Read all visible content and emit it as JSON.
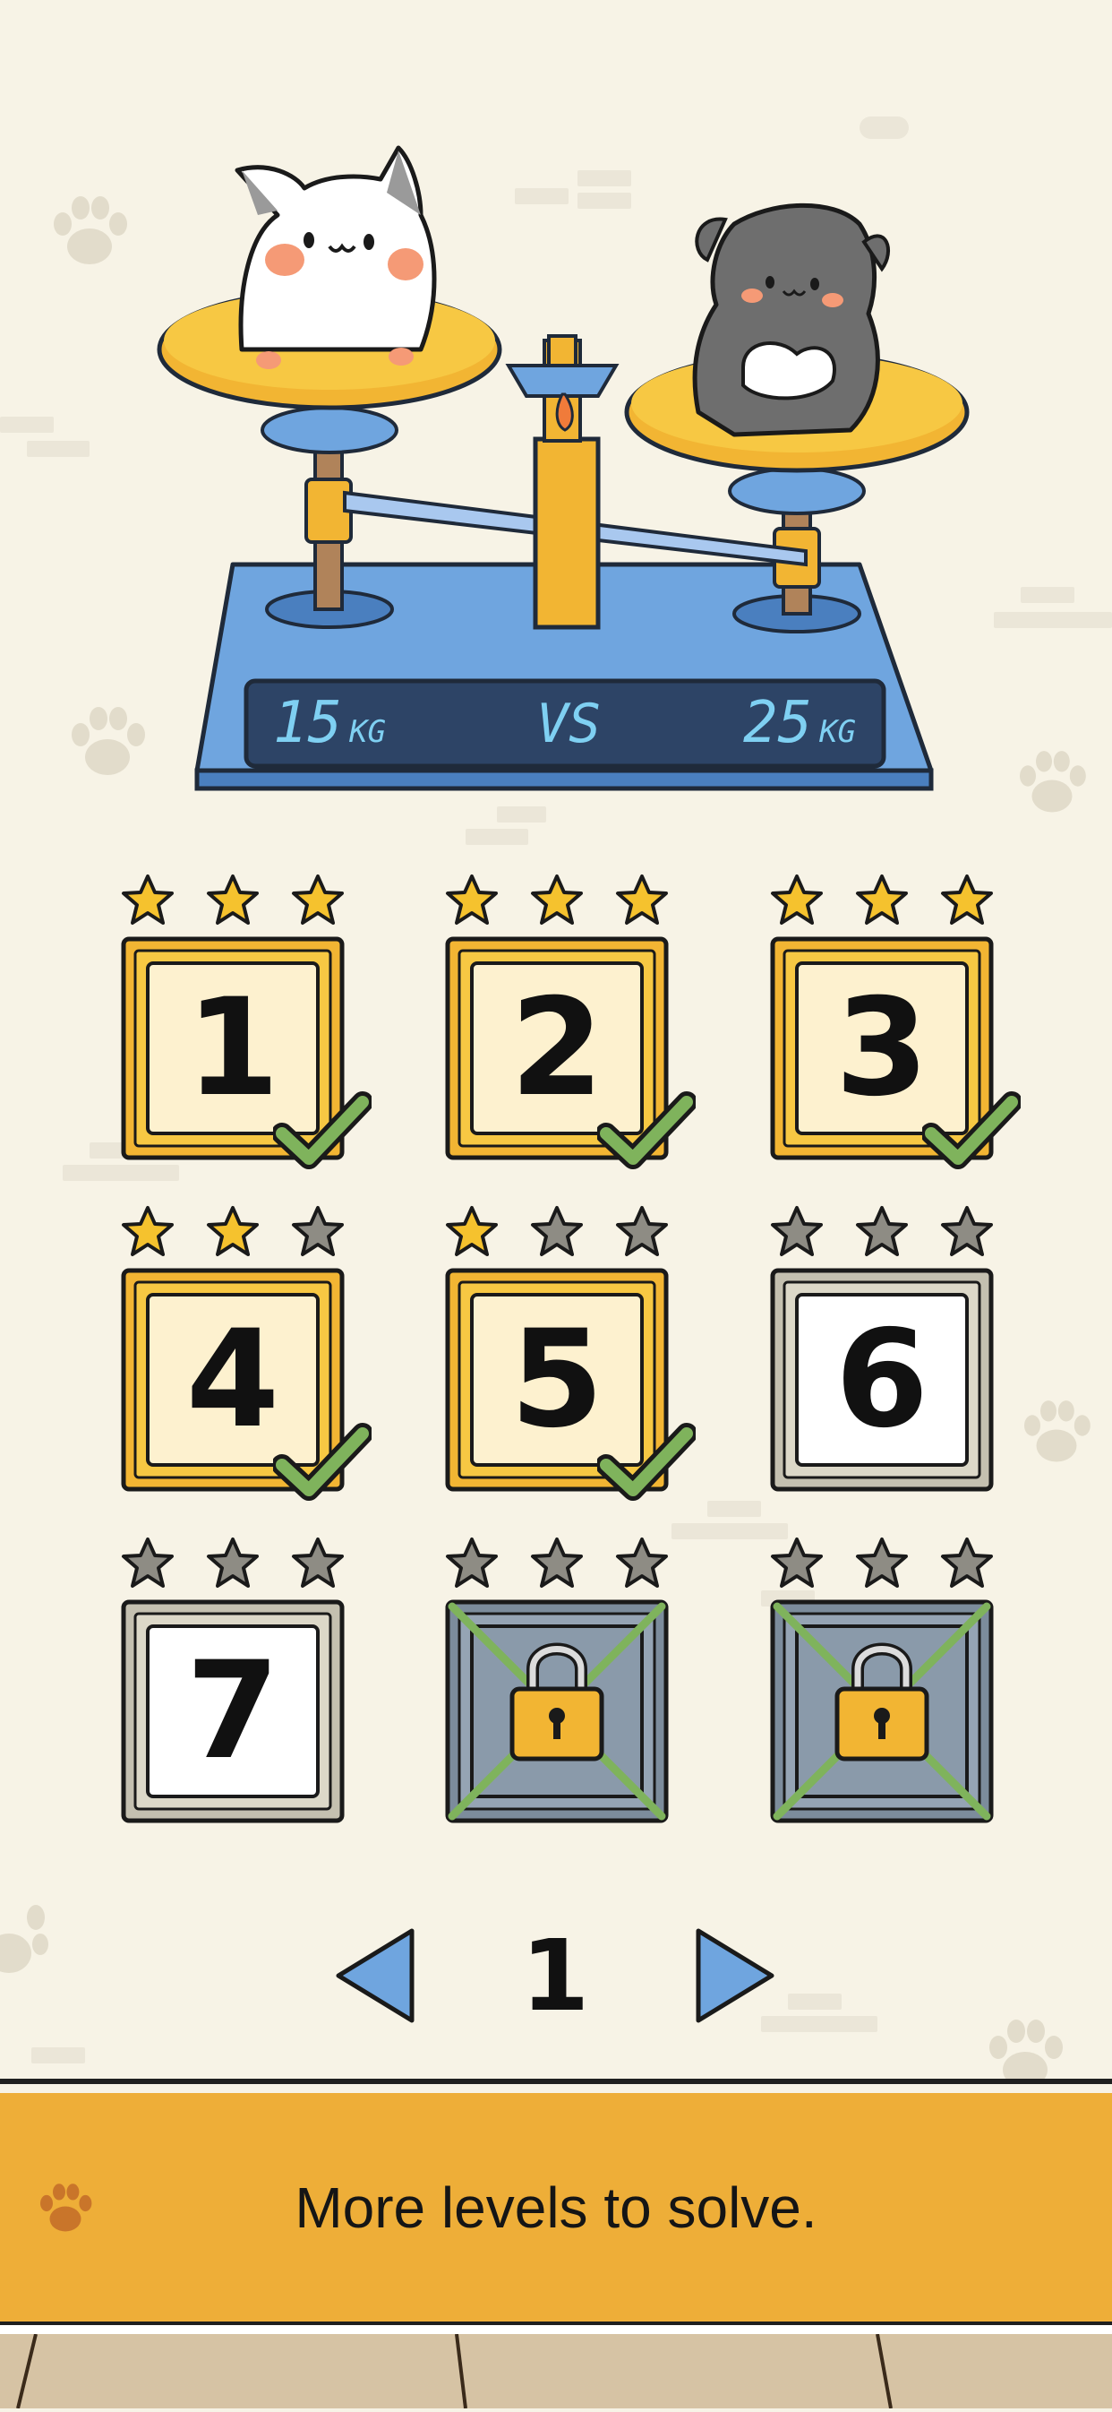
{
  "scale": {
    "left_weight": "15",
    "left_unit": "KG",
    "vs_label": "VS",
    "right_weight": "25",
    "right_unit": "KG"
  },
  "levels": [
    {
      "number": "1",
      "stars": 3,
      "completed": true,
      "locked": false,
      "tier": "gold"
    },
    {
      "number": "2",
      "stars": 3,
      "completed": true,
      "locked": false,
      "tier": "gold"
    },
    {
      "number": "3",
      "stars": 3,
      "completed": true,
      "locked": false,
      "tier": "gold"
    },
    {
      "number": "4",
      "stars": 2,
      "completed": true,
      "locked": false,
      "tier": "gold"
    },
    {
      "number": "5",
      "stars": 1,
      "completed": true,
      "locked": false,
      "tier": "gold"
    },
    {
      "number": "6",
      "stars": 0,
      "completed": false,
      "locked": false,
      "tier": "silver"
    },
    {
      "number": "7",
      "stars": 0,
      "completed": false,
      "locked": false,
      "tier": "silver"
    },
    {
      "number": "",
      "stars": 0,
      "completed": false,
      "locked": true,
      "tier": "locked"
    },
    {
      "number": "",
      "stars": 0,
      "completed": false,
      "locked": true,
      "tier": "locked"
    }
  ],
  "pager": {
    "page": "1"
  },
  "banner": {
    "text": "More levels to solve."
  },
  "colors": {
    "background": "#f7f3e6",
    "banner": "#eeae38",
    "star_filled": "#f5c22e",
    "star_empty": "#8e8c84",
    "tile_gold": "#f7c843",
    "tile_silver": "#dcd8c8",
    "check": "#7fb35c",
    "arrow": "#6fa5df",
    "scale_blue": "#6fa5df"
  }
}
